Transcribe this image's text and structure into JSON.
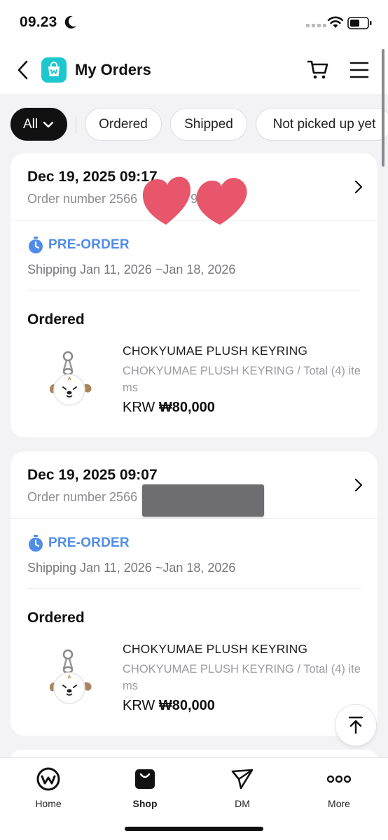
{
  "status_bar": {
    "time": "09.23"
  },
  "header": {
    "title": "My Orders"
  },
  "filters": [
    {
      "label": "All",
      "active": true
    },
    {
      "label": "Ordered",
      "active": false
    },
    {
      "label": "Shipped",
      "active": false
    },
    {
      "label": "Not picked up yet",
      "active": false
    }
  ],
  "orders": [
    {
      "date": "Dec 19, 2025 09:17",
      "order_number": "Order number 2566",
      "order_number_tail": "9",
      "badge": "PRE-ORDER",
      "shipping": "Shipping Jan 11, 2026 ~Jan 18, 2026",
      "status": "Ordered",
      "product_name": "CHOKYUMAE PLUSH KEYRING",
      "product_meta": "CHOKYUMAE PLUSH KEYRING / Total (4) items",
      "currency": "KRW",
      "price": "₩80,000"
    },
    {
      "date": "Dec 19, 2025 09:07",
      "order_number": "Order number 2566",
      "order_number_tail": "",
      "badge": "PRE-ORDER",
      "shipping": "Shipping Jan 11, 2026 ~Jan 18, 2026",
      "status": "Ordered",
      "product_name": "CHOKYUMAE PLUSH KEYRING",
      "product_meta": "CHOKYUMAE PLUSH KEYRING / Total (4) items",
      "currency": "KRW",
      "price": "₩80,000"
    }
  ],
  "bottom_nav": [
    {
      "label": "Home",
      "icon": "home-logo-icon",
      "active": false
    },
    {
      "label": "Shop",
      "icon": "shopping-bag-icon",
      "active": true
    },
    {
      "label": "DM",
      "icon": "paper-plane-icon",
      "active": false
    },
    {
      "label": "More",
      "icon": "more-dots-icon",
      "active": false
    }
  ],
  "colors": {
    "accent": "#1cc7cf",
    "preorder": "#4f8ce8",
    "redaction_heart": "#e8566b"
  }
}
